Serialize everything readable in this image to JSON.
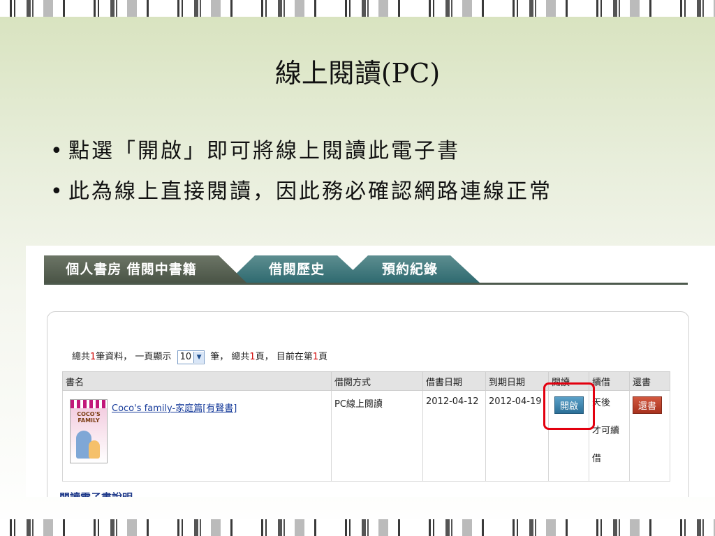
{
  "slide": {
    "title": "線上閱讀(PC)",
    "bullets": [
      "點選「開啟」即可將線上閱讀此電子書",
      "此為線上直接閱讀，因此務必確認網路連線正常"
    ],
    "bullet_mark": "•"
  },
  "tabs": {
    "active": "個人書房 借閱中書籍",
    "second": "借閱歷史",
    "third": "預約紀錄"
  },
  "summary": {
    "prefix": "總共",
    "count": "1",
    "middle": "筆資料， 一頁顯示",
    "page_size": "10",
    "after_select": "筆， 總共",
    "pages": "1",
    "pages_suffix": "頁， 目前在第",
    "current_page": "1",
    "current_suffix": "頁"
  },
  "table": {
    "headers": [
      "書名",
      "借閱方式",
      "借書日期",
      "到期日期",
      "閱讀",
      "續借",
      "還書"
    ],
    "rows": [
      {
        "title": "Coco's family-家庭篇[有聲書]",
        "method": "PC線上閱讀",
        "borrow_date": "2012-04-12",
        "due_date": "2012-04-19",
        "open_label": "開啟",
        "renew_lines": [
          "天後",
          "才可續",
          "借"
        ],
        "return_label": "還書",
        "cover_logo": "COCO'S FAMILY"
      }
    ]
  },
  "footer": {
    "link": "閱讀電子書說明"
  },
  "colors": {
    "highlight": "#e3000f",
    "tab_active": "#4a5446",
    "tab_inactive": "#2f6a70",
    "open_button": "#2b6f97",
    "return_button": "#a7311d",
    "link": "#1a3e9c"
  },
  "icons": {
    "page_size_arrow": "chevron-down-icon"
  }
}
